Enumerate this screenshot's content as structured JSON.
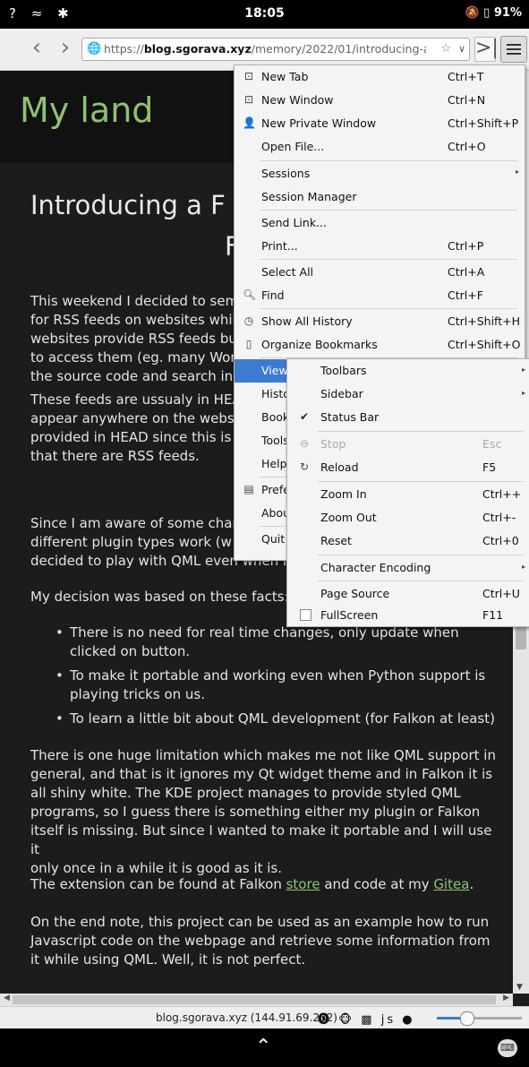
{
  "status": {
    "left_icons": "? ≈ ✱",
    "time": "18:05",
    "battery": "91%",
    "right_icons": "🔕 ▯"
  },
  "toolbar": {
    "back": "‹",
    "forward": "›",
    "url_scheme": "https://",
    "url_host": "blog.sgorava.xyz",
    "url_path": "/memory/2022/01/introducing-a-falkon-",
    "site_icon": "🌐",
    "star": "☆",
    "drop": "∨",
    "sidebar": ">|"
  },
  "page": {
    "site_title": "My land",
    "post_title_1": "Introducing a F",
    "post_title_2": "F",
    "paragraphs": [
      "This weekend I decided to sem",
      "for RSS feeds on websites whil",
      "websites provide RSS feeds bu",
      "to access them (eg. many Wor",
      "the source code and search in"
    ],
    "p2": [
      "These feeds are ussualy in HEA",
      "appear anywhere on the websi",
      "provided in HEAD since this is",
      "that there are RSS feeds."
    ],
    "p3": [
      "Since I am aware of some char",
      "different plugin types work (w",
      "decided to play with QML even when I d"
    ],
    "p4": "My decision was based on these facts:",
    "bullets": [
      [
        "There is no need for real time changes, only update when",
        "clicked on button."
      ],
      [
        "To make it portable and working even when Python support is",
        "playing tricks on us."
      ],
      [
        "To learn a little bit about QML development (for Falkon at least)"
      ]
    ],
    "p5": [
      "There is one huge limitation which makes me not like QML support in",
      "general, and that is it ignores my Qt widget theme and in Falkon it is",
      "all shiny white. The KDE project manages to provide styled QML",
      "programs, so I guess there is something either my plugin or Falkon",
      "itself is missing. But since I wanted to make it portable and I will use it",
      "only once in a while it is good as it is."
    ],
    "p6_before": "The extension can be found at Falkon ",
    "p6_store": "store",
    "p6_middle": " and code at my ",
    "p6_gitea": "Gitea",
    "p6_after": ".",
    "p7": [
      "On the end note, this project can be used as an example how to run",
      "Javascript code on the webpage and retrieve some information from",
      "it while using QML. Well, it is not perfect."
    ]
  },
  "menu": {
    "items": [
      {
        "icon": "⊡",
        "label": "New Tab",
        "shortcut": "Ctrl+T"
      },
      {
        "icon": "⊡",
        "label": "New Window",
        "shortcut": "Ctrl+N"
      },
      {
        "icon": "👤",
        "label": "New Private Window",
        "shortcut": "Ctrl+Shift+P"
      },
      {
        "icon": "",
        "label": "Open File...",
        "shortcut": "Ctrl+O"
      },
      {
        "icon": "",
        "label": "Sessions",
        "shortcut": "",
        "sub": "▸"
      },
      {
        "icon": "",
        "label": "Session Manager",
        "shortcut": ""
      },
      {
        "icon": "",
        "label": "Send Link...",
        "shortcut": ""
      },
      {
        "icon": "",
        "label": "Print...",
        "shortcut": "Ctrl+P"
      },
      {
        "icon": "",
        "label": "Select All",
        "shortcut": "Ctrl+A"
      },
      {
        "icon": "🔍︎",
        "label": "Find",
        "shortcut": "Ctrl+F"
      },
      {
        "icon": "◷",
        "label": "Show All History",
        "shortcut": "Ctrl+Shift+H"
      },
      {
        "icon": "▯",
        "label": "Organize Bookmarks",
        "shortcut": "Ctrl+Shift+O"
      },
      {
        "icon": "",
        "label": "View",
        "shortcut": ""
      },
      {
        "icon": "",
        "label": "History",
        "shortcut": ""
      },
      {
        "icon": "",
        "label": "Bookm",
        "shortcut": ""
      },
      {
        "icon": "",
        "label": "Tools",
        "shortcut": ""
      },
      {
        "icon": "",
        "label": "Help",
        "shortcut": ""
      },
      {
        "icon": "▤",
        "label": "Prefere",
        "shortcut": ""
      },
      {
        "icon": "",
        "label": "About",
        "shortcut": ""
      },
      {
        "icon": "",
        "label": "Quit",
        "shortcut": ""
      }
    ]
  },
  "submenu": {
    "items": [
      {
        "label": "Toolbars",
        "shortcut": "",
        "sub": "▸"
      },
      {
        "label": "Sidebar",
        "shortcut": "",
        "sub": "▸"
      },
      {
        "label": "Status Bar",
        "shortcut": "",
        "icon": "✔"
      },
      {
        "label": "Stop",
        "shortcut": "Esc",
        "icon": "⊖"
      },
      {
        "label": "Reload",
        "shortcut": "F5",
        "icon": "↻"
      },
      {
        "label": "Zoom In",
        "shortcut": "Ctrl++"
      },
      {
        "label": "Zoom Out",
        "shortcut": "Ctrl+-"
      },
      {
        "label": "Reset",
        "shortcut": "Ctrl+0"
      },
      {
        "label": "Character Encoding",
        "shortcut": "",
        "sub": "▸"
      },
      {
        "label": "Page Source",
        "shortcut": "Ctrl+U"
      },
      {
        "label": "FullScreen",
        "shortcut": "F11"
      }
    ]
  },
  "browser_status": {
    "host": "blog.sgorava.xyz (144.91.69.232)",
    "icons": "⓿ 🐵 ▩ js ●"
  },
  "navbar": {
    "up": "⌃",
    "keyboard": "⌨"
  }
}
